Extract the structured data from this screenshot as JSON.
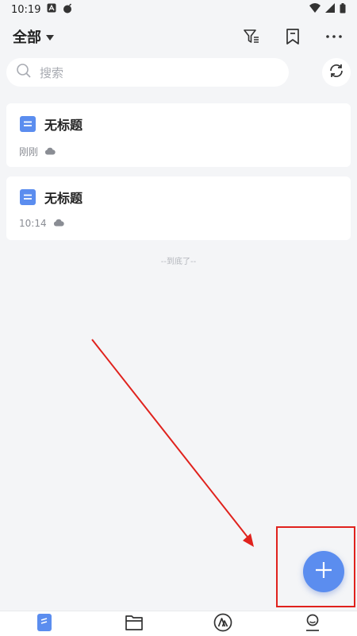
{
  "status_bar": {
    "time": "10:19"
  },
  "header": {
    "filter_label": "全部",
    "icons": [
      "filter-icon",
      "bookmark-icon",
      "more-icon"
    ]
  },
  "search": {
    "placeholder": "搜索"
  },
  "notes": [
    {
      "title": "无标题",
      "time": "刚刚",
      "sync": "cloud-icon"
    },
    {
      "title": "无标题",
      "time": "10:14",
      "sync": "cloud-icon"
    }
  ],
  "list_end": "--到底了--",
  "bottom_nav": [
    "notes-tab",
    "folder-tab",
    "ai-tab",
    "profile-tab"
  ],
  "colors": {
    "accent": "#5b8def",
    "annotation": "#e0221d",
    "background": "#f4f5f7"
  }
}
